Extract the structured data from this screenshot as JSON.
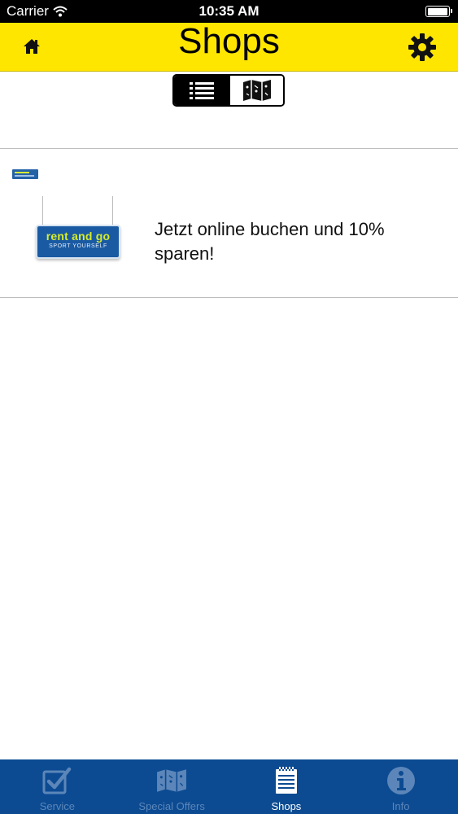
{
  "status_bar": {
    "carrier": "Carrier",
    "time": "10:35 AM",
    "battery_level": 1.0
  },
  "nav_bar": {
    "title": "Shops",
    "left_icon": "home-icon",
    "right_icon": "gear-icon",
    "background_color": "#ffe600"
  },
  "view_toggle": {
    "options": [
      {
        "icon": "list-icon",
        "selected": true
      },
      {
        "icon": "map-icon",
        "selected": false
      }
    ]
  },
  "shops": [
    {
      "logo_brand": "rent and go",
      "logo_tagline": "SPORT YOURSELF",
      "text": "Jetzt online buchen und 10% sparen!"
    }
  ],
  "tab_bar": {
    "background_color": "#0c4b92",
    "tabs": [
      {
        "label": "Service",
        "icon": "checkbox-icon",
        "selected": false
      },
      {
        "label": "Special Offers",
        "icon": "map-icon",
        "selected": false
      },
      {
        "label": "Shops",
        "icon": "notepad-icon",
        "selected": true
      },
      {
        "label": "Info",
        "icon": "info-icon",
        "selected": false
      }
    ]
  }
}
